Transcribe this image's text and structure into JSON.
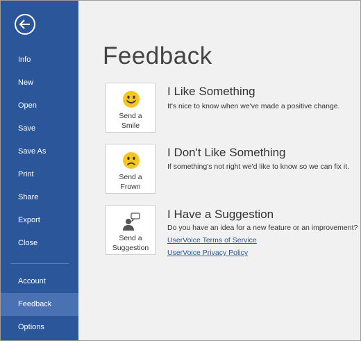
{
  "sidebar": {
    "items": [
      {
        "label": "Info"
      },
      {
        "label": "New"
      },
      {
        "label": "Open"
      },
      {
        "label": "Save"
      },
      {
        "label": "Save As"
      },
      {
        "label": "Print"
      },
      {
        "label": "Share"
      },
      {
        "label": "Export"
      },
      {
        "label": "Close"
      }
    ],
    "bottom_items": [
      {
        "label": "Account"
      },
      {
        "label": "Feedback",
        "active": true
      },
      {
        "label": "Options"
      }
    ],
    "back_icon": "back-arrow-icon",
    "color": "#2b579a",
    "active_color": "#4a72b2"
  },
  "main": {
    "title": "Feedback",
    "options": [
      {
        "card_label_1": "Send a",
        "card_label_2": "Smile",
        "icon": "smile-icon",
        "title": "I Like Something",
        "description": "It's nice to know when we've made a positive change."
      },
      {
        "card_label_1": "Send a",
        "card_label_2": "Frown",
        "icon": "frown-icon",
        "title": "I Don't Like Something",
        "description": "If something's not right we'd like to know so we can fix it."
      },
      {
        "card_label_1": "Send a",
        "card_label_2": "Suggestion",
        "icon": "suggestion-person-icon",
        "title": "I Have a Suggestion",
        "description": "Do you have an idea for a new feature or an improvement?",
        "links": [
          "UserVoice Terms of Service",
          "UserVoice Privacy Policy"
        ]
      }
    ],
    "emoji_color": "#f7c51f",
    "link_color": "#2b579a"
  }
}
